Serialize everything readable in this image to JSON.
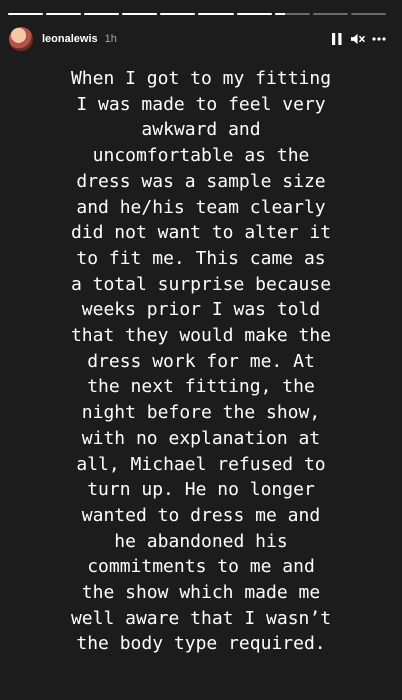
{
  "story": {
    "username": "leonalewis",
    "time_ago": "1h",
    "progress_segments": [
      1,
      1,
      1,
      1,
      1,
      1,
      1,
      0.3,
      0,
      0
    ],
    "text": "When I got to my fitting\nI was made to feel very\nawkward and\nuncomfortable as the\ndress was a sample size\nand he/his team clearly\ndid not want to alter it\nto fit me. This came as\na total surprise because\nweeks prior I was told\nthat they would make the\ndress work for me.  At\nthe next fitting, the\nnight before the show,\nwith no explanation at\nall, Michael refused to\nturn up. He no longer\nwanted to dress me and\nhe abandoned his\ncommitments to me and\nthe show which made me\nwell aware that I wasn’t\nthe body type required."
  },
  "icons": {
    "pause": "pause-icon",
    "mute": "speaker-muted-icon",
    "more": "more-options-icon"
  },
  "colors": {
    "background": "#1c1c1c",
    "text": "#ffffff"
  }
}
